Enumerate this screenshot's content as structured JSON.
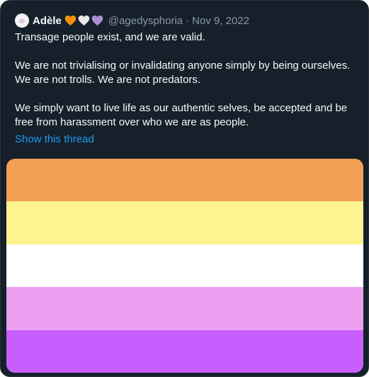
{
  "tweet": {
    "display_name": "Adèle",
    "handle": "@agedysphoria",
    "separator": "·",
    "date": "Nov 9, 2022",
    "name_emojis": [
      "orange-heart",
      "white-heart",
      "purple-heart"
    ],
    "paragraphs": [
      "Transage people exist, and we are valid.",
      "We are not trivialising or invalidating anyone simply by being ourselves. We are not trolls. We are not predators.",
      "We simply want to live life as our authentic selves, be accepted and be free from harassment over who we are as people."
    ],
    "thread_link": "Show this thread"
  },
  "colors": {
    "background": "#15202b",
    "text": "#f7f9f9",
    "muted": "#8b98a5",
    "link": "#1d9bf0",
    "heart_orange": "#f4900c",
    "heart_white": "#e8e8e8",
    "heart_purple": "#aa8ed6"
  },
  "flag_stripes": [
    "#f2a154",
    "#fdf48d",
    "#ffffff",
    "#ec9ef1",
    "#c95efe"
  ]
}
